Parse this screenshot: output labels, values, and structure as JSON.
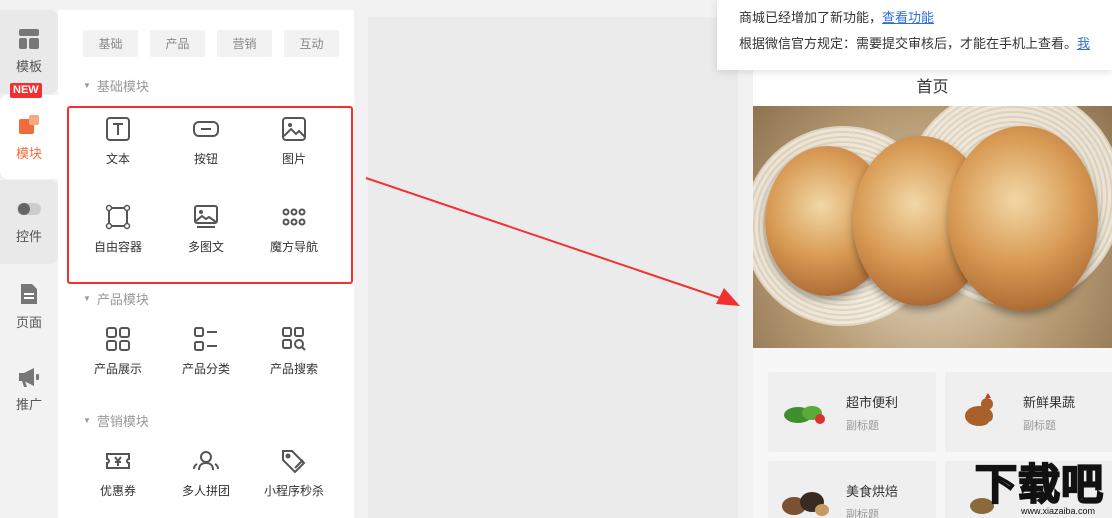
{
  "rail": {
    "template_label": "模板",
    "module_label": "模块",
    "control_label": "控件",
    "page_label": "页面",
    "page_badge": "NEW",
    "promote_label": "推广"
  },
  "panel": {
    "tabs": [
      "基础",
      "产品",
      "营销",
      "互动"
    ],
    "sections": {
      "basic": {
        "title": "基础模块",
        "items": [
          "文本",
          "按钮",
          "图片",
          "自由容器",
          "多图文",
          "魔方导航"
        ]
      },
      "product": {
        "title": "产品模块",
        "items": [
          "产品展示",
          "产品分类",
          "产品搜索"
        ]
      },
      "marketing": {
        "title": "营销模块",
        "items": [
          "优惠券",
          "多人拼团",
          "小程序秒杀"
        ]
      }
    }
  },
  "notice": {
    "line1": "商城已经增加了新功能，",
    "line1_link": "查看功能",
    "line2": "根据微信官方规定：需要提交审核后，才能在手机上查看。",
    "line2_link": "我"
  },
  "phone": {
    "title": "首页",
    "nav_cards": [
      {
        "title": "超市便利",
        "subtitle": "副标题"
      },
      {
        "title": "新鲜果蔬",
        "subtitle": "副标题"
      },
      {
        "title": "美食烘焙",
        "subtitle": "副标题"
      },
      {
        "title": "",
        "subtitle": ""
      }
    ]
  },
  "watermark": {
    "big": "下载吧",
    "small": "www.xiazaiba.com"
  },
  "colors": {
    "accent": "#f26b3a",
    "highlight": "#f23030",
    "link": "#2f6fd6"
  }
}
